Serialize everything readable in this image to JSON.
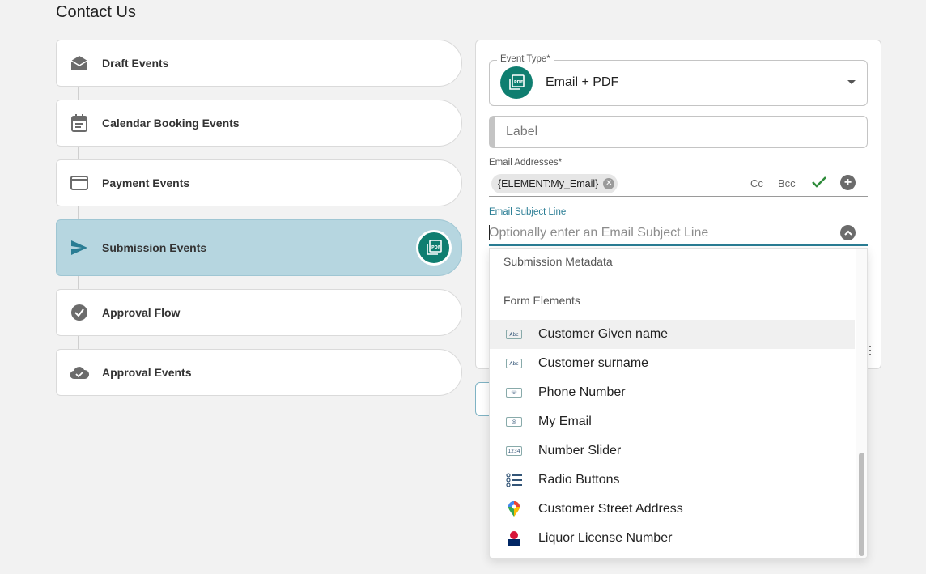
{
  "page": {
    "title": "Contact Us"
  },
  "events": [
    {
      "label": "Draft Events",
      "icon": "mail-open-icon",
      "active": false
    },
    {
      "label": "Calendar Booking Events",
      "icon": "calendar-icon",
      "active": false
    },
    {
      "label": "Payment Events",
      "icon": "credit-card-icon",
      "active": false
    },
    {
      "label": "Submission Events",
      "icon": "send-icon",
      "active": true
    },
    {
      "label": "Approval Flow",
      "icon": "check-circle-icon",
      "active": false
    },
    {
      "label": "Approval Events",
      "icon": "cloud-done-icon",
      "active": false
    }
  ],
  "event_type": {
    "legend": "Event Type*",
    "value": "Email + PDF",
    "icon": "pdf-icon"
  },
  "label_field": {
    "placeholder": "Label"
  },
  "email_addresses": {
    "label": "Email Addresses*",
    "chip": "{ELEMENT:My_Email}",
    "cc": "Cc",
    "bcc": "Bcc"
  },
  "subject": {
    "label": "Email Subject Line",
    "placeholder": "Optionally enter an Email Subject Line"
  },
  "dropdown": {
    "sections": [
      "Submission Metadata",
      "Form Elements"
    ],
    "items": [
      {
        "label": "Customer Given name",
        "icon": "text-field-icon"
      },
      {
        "label": "Customer surname",
        "icon": "text-field-icon"
      },
      {
        "label": "Phone Number",
        "icon": "phone-field-icon"
      },
      {
        "label": "My Email",
        "icon": "email-field-icon"
      },
      {
        "label": "Number Slider",
        "icon": "number-field-icon"
      },
      {
        "label": "Radio Buttons",
        "icon": "radio-list-icon"
      },
      {
        "label": "Customer Street Address",
        "icon": "map-pin-icon"
      },
      {
        "label": "Liquor License Number",
        "icon": "nsw-logo-icon"
      }
    ]
  },
  "colors": {
    "teal": "#0f7e70",
    "active_bg": "#b6d6e0",
    "accent": "#2a7d94",
    "check": "#2e8b3a"
  }
}
